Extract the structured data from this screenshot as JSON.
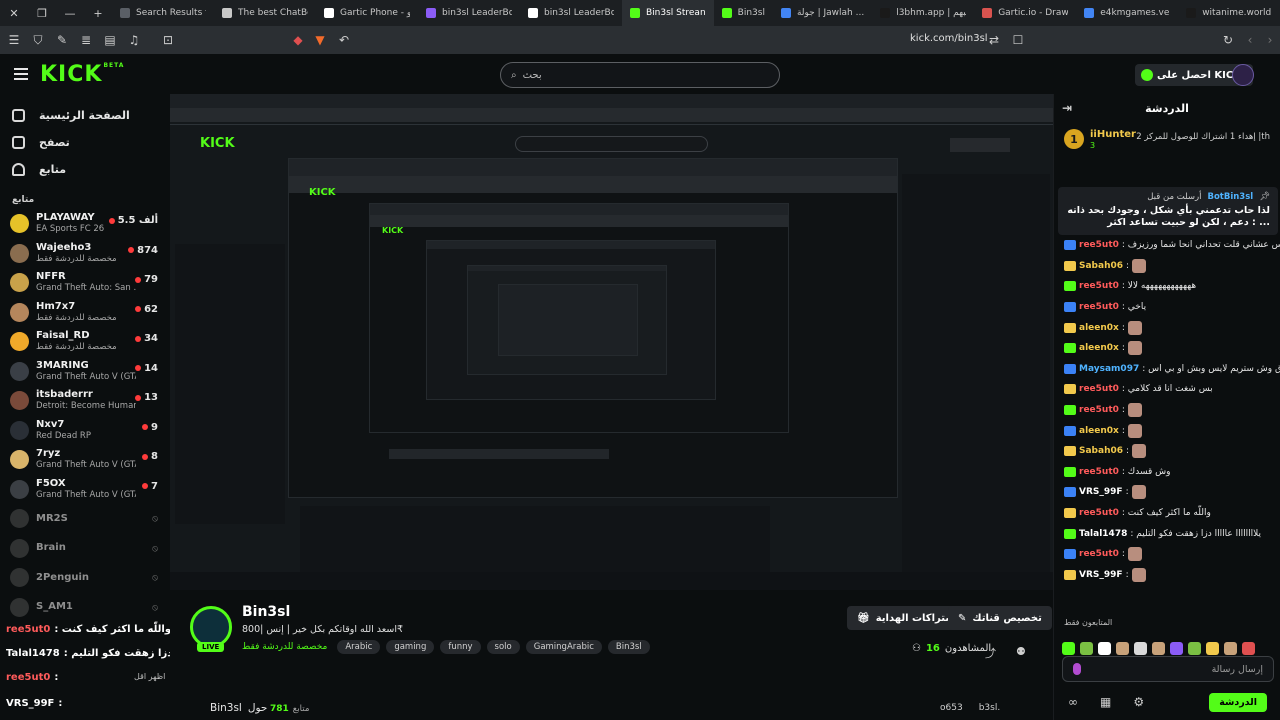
{
  "browser": {
    "tabs": [
      {
        "label": "Search Results fo",
        "color": "#5a5f66",
        "active": false
      },
      {
        "label": "The best ChatBot",
        "color": "#c8c8c8",
        "active": false
      },
      {
        "label": "Gartic Phone - جو",
        "color": "#ffffff",
        "active": false
      },
      {
        "label": "bin3sl LeaderBoa",
        "color": "#8b5cf6",
        "active": false
      },
      {
        "label": "bin3sl LeaderBoa",
        "color": "#ffffff",
        "active": false
      },
      {
        "label": "Bin3sl Strean",
        "color": "#53fc18",
        "active": true
      },
      {
        "label": "Bin3sl",
        "color": "#53fc18",
        "active": false
      },
      {
        "label": "جولة | Jawlah ...",
        "color": "#4285f4",
        "active": false
      },
      {
        "label": "l3bhm.app | لعبهم",
        "color": "#1a1a1a",
        "active": false
      },
      {
        "label": "Gartic.io - Draw,",
        "color": "#d9534f",
        "active": false
      },
      {
        "label": "e4kmgames.verc",
        "color": "#4285f4",
        "active": false
      },
      {
        "label": "witanime.world",
        "color": "#1a1a1a",
        "active": false
      }
    ],
    "url": "kick.com/bin3sl"
  },
  "header": {
    "logo": "KICK",
    "logo_beta": "BETA",
    "search_placeholder": "بحث",
    "get_kicks": "احصل على KICKs"
  },
  "sidebar": {
    "nav": [
      {
        "label": "الصفحة الرئيسية",
        "icon": "home-icon"
      },
      {
        "label": "تصفح",
        "icon": "browse-icon"
      },
      {
        "label": "متابع",
        "icon": "heart-icon"
      }
    ],
    "following_title": "متابع",
    "channels": [
      {
        "name": "PLAYAWAY",
        "game": "EA Sports FC 26",
        "viewers": "5.5 ألف",
        "color": "#e6c229",
        "live": true
      },
      {
        "name": "Wajeeho3",
        "game": "مخصصة للدردشة فقط",
        "viewers": "874",
        "color": "#8a6d4f",
        "live": true
      },
      {
        "name": "NFFR",
        "game": "Grand Theft Auto: San ...",
        "viewers": "79",
        "color": "#c9a24a",
        "live": true
      },
      {
        "name": "Hm7x7",
        "game": "مخصصة للدردشة فقط",
        "viewers": "62",
        "color": "#b5865c",
        "live": true
      },
      {
        "name": "Faisal_RD",
        "game": "مخصصة للدردشة فقط",
        "viewers": "34",
        "color": "#f0a92a",
        "live": true
      },
      {
        "name": "3MARING",
        "game": "Grand Theft Auto V (GTA)",
        "viewers": "14",
        "color": "#3a3f46",
        "live": true
      },
      {
        "name": "itsbaderrr",
        "game": "Detroit: Become Human",
        "viewers": "13",
        "color": "#7a4a3a",
        "live": true
      },
      {
        "name": "Nxv7",
        "game": "Red Dead RP",
        "viewers": "9",
        "color": "#2a2f36",
        "live": true
      },
      {
        "name": "7ryz",
        "game": "Grand Theft Auto V (GTA)",
        "viewers": "8",
        "color": "#d9b46a",
        "live": true
      },
      {
        "name": "F5OX",
        "game": "Grand Theft Auto V (GTA)",
        "viewers": "7",
        "color": "#3b3f44",
        "live": true
      },
      {
        "name": "MR2S",
        "game": "",
        "viewers": "",
        "color": "#555",
        "live": false
      },
      {
        "name": "Brain",
        "game": "",
        "viewers": "",
        "color": "#555",
        "live": false
      },
      {
        "name": "2Penguin",
        "game": "",
        "viewers": "",
        "color": "#555",
        "live": false
      },
      {
        "name": "S_AM1",
        "game": "",
        "viewers": "",
        "color": "#555",
        "live": false
      }
    ]
  },
  "overlay_chat": [
    {
      "user": "ree5ut0",
      "text": ": واللّه ما اكثر كيف كنت",
      "user_color": "#ff5b5b"
    },
    {
      "user": "Talal1478",
      "text": ": يلاااااااا عاااااااا دزا زهقت فكو التليم",
      "user_color": "#ffffff"
    },
    {
      "user": "ree5ut0",
      "text": ":",
      "user_color": "#ff5b5b"
    },
    {
      "user": "VRS_99F",
      "text": ":",
      "user_color": "#ffffff"
    }
  ],
  "overlay_labels": {
    "show_more": "اظهر اقل"
  },
  "stream": {
    "channel_name": "Bin3sl",
    "live": "LIVE",
    "title": "اسعد الله اوقاتكم بكل خير | إنس |800₹",
    "category": "مخصصة للدردشة فقط",
    "tags": [
      "Arabic",
      "gaming",
      "funny",
      "solo",
      "GamingArabic",
      "Bin3sl"
    ],
    "subscribe_btn": "تخصيص قناتك",
    "gift_btn": "الاشتراكات الهداية",
    "viewers_label": "المشاهدون",
    "viewers_count": "16",
    "about_label": "حول",
    "about_name": "Bin3sl",
    "followers_count": "781",
    "followers_label": "متابع",
    "social": [
      "o653",
      "b3sl."
    ]
  },
  "chat": {
    "title": "الدردشة",
    "top_gifter": {
      "name": "iiHunter",
      "count": "3",
      "rank": "1",
      "text": "إهداء 1 اشتراك للوصول للمركز 2 |th"
    },
    "pinned": {
      "header_user": "BotBin3sl",
      "header_text": "أرسلت من قبل",
      "text": "لذا حاب تدعمني بأي شكل ، وجودك بحد ذاته دعم ، لكن لو حبيت تساعد اكثر : ..."
    },
    "messages": [
      {
        "user": "ree5ut0",
        "text": ": ترا قملا يس عشاني قلت تحداني انحا شما ورزيزف",
        "color": "#ff5b5b",
        "emote": false
      },
      {
        "user": "Sabah06",
        "text": ":",
        "color": "#f2c94c",
        "emote": true
      },
      {
        "user": "ree5ut0",
        "text": ": ههههههههههههه لالا",
        "color": "#ff5b5b",
        "emote": false
      },
      {
        "user": "ree5ut0",
        "text": ": ياخي",
        "color": "#ff5b5b",
        "emote": false
      },
      {
        "user": "aleen0x",
        "text": ":",
        "color": "#f2c94c",
        "emote": true
      },
      {
        "user": "aleen0x",
        "text": ":",
        "color": "#f2c94c",
        "emote": true
      },
      {
        "user": "Maysam097",
        "text": ": وش الفرق وش ستريم لايس وبش او بي اس",
        "color": "#4fb3ff",
        "emote": false
      },
      {
        "user": "ree5ut0",
        "text": ": بس شغت انا قد كلامي",
        "color": "#ff5b5b",
        "emote": false
      },
      {
        "user": "ree5ut0",
        "text": ":",
        "color": "#ff5b5b",
        "emote": true
      },
      {
        "user": "aleen0x",
        "text": ":",
        "color": "#f2c94c",
        "emote": true
      },
      {
        "user": "Sabah06",
        "text": ":",
        "color": "#f2c94c",
        "emote": true
      },
      {
        "user": "ree5ut0",
        "text": ": وش قسدك",
        "color": "#ff5b5b",
        "emote": false
      },
      {
        "user": "VRS_99F",
        "text": ":",
        "color": "#ffffff",
        "emote": true
      },
      {
        "user": "ree5ut0",
        "text": ": واللّه ما اكثر كيف كنت",
        "color": "#ff5b5b",
        "emote": false
      },
      {
        "user": "Talal1478",
        "text": ": يلاااااااا عااااا دزا زهقت فكو التليم",
        "color": "#ffffff",
        "emote": false
      },
      {
        "user": "ree5ut0",
        "text": ":",
        "color": "#ff5b5b",
        "emote": true
      },
      {
        "user": "VRS_99F",
        "text": ":",
        "color": "#ffffff",
        "emote": true
      }
    ],
    "emotes_label": "المتابعون فقط",
    "input_placeholder": "إرسال رسالة",
    "send_label": "الدردشة"
  }
}
